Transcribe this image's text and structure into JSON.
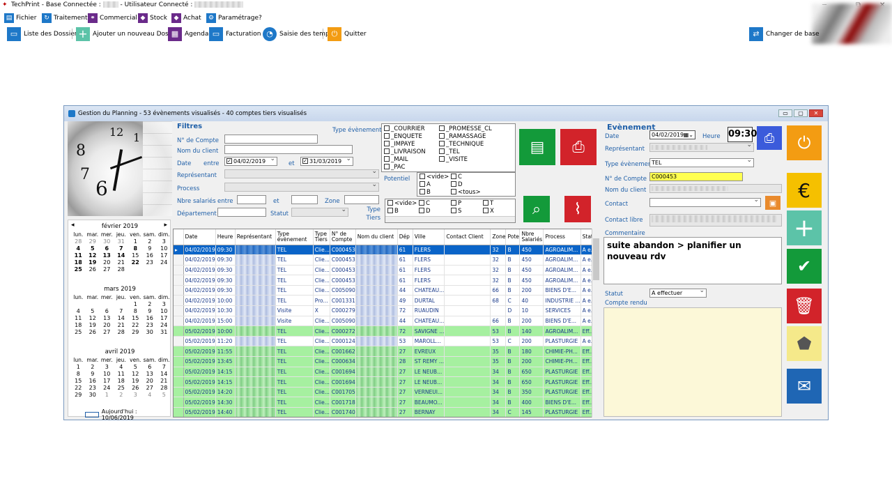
{
  "app": {
    "title": "TechPrint - Base Connectée :",
    "user_label": "- Utilisateur Connecté :",
    "min": "─",
    "max": "⧉",
    "close": "✕"
  },
  "menu": [
    {
      "label": "Fichier",
      "icon": "file-icon",
      "color": "#1e78c8"
    },
    {
      "label": "Traitement",
      "icon": "refresh-icon",
      "color": "#1e78c8"
    },
    {
      "label": "Commercial",
      "icon": "handshake-icon",
      "color": "#6a2a8a"
    },
    {
      "label": "Stock",
      "icon": "tag-icon",
      "color": "#6a2a8a"
    },
    {
      "label": "Achat",
      "icon": "tag-icon",
      "color": "#6a2a8a"
    },
    {
      "label": "Paramétrage",
      "icon": "gear-icon",
      "color": "#1e78c8"
    },
    {
      "label": "?",
      "icon": "",
      "color": ""
    }
  ],
  "toolbar": {
    "liste": "Liste des Dossiers",
    "ajouter": "Ajouter un nouveau Dossier",
    "agenda": "Agenda",
    "facturation": "Facturation BL",
    "saisie": "Saisie des temps",
    "quitter": "Quitter",
    "changer": "Changer de base"
  },
  "window": {
    "title": "Gestion du Planning - 53 évènements visualisés - 40 comptes tiers visualisés",
    "min": "▭",
    "max": "▢",
    "close": "✕"
  },
  "clock": {
    "n1": "12",
    "n2": "1",
    "n8": "8",
    "n7": "7",
    "n6": "6"
  },
  "calendar": {
    "prev": "◂",
    "next": "▸",
    "days": [
      "lun.",
      "mar.",
      "mer.",
      "jeu.",
      "ven.",
      "sam.",
      "dim."
    ],
    "months": [
      {
        "title": "février 2019",
        "cells": [
          [
            "28",
            "g"
          ],
          [
            "29",
            "g"
          ],
          [
            "30",
            "g"
          ],
          [
            "31",
            "g"
          ],
          [
            "1",
            ""
          ],
          [
            "2",
            ""
          ],
          [
            "3",
            ""
          ],
          [
            "4",
            "b"
          ],
          [
            "5",
            "b"
          ],
          [
            "6",
            "b"
          ],
          [
            "7",
            "b"
          ],
          [
            "8",
            "b"
          ],
          [
            "9",
            ""
          ],
          [
            "10",
            ""
          ],
          [
            "11",
            "b"
          ],
          [
            "12",
            "b"
          ],
          [
            "13",
            "b"
          ],
          [
            "14",
            "b"
          ],
          [
            "15",
            ""
          ],
          [
            "16",
            ""
          ],
          [
            "17",
            ""
          ],
          [
            "18",
            "b"
          ],
          [
            "19",
            "b"
          ],
          [
            "20",
            ""
          ],
          [
            "21",
            ""
          ],
          [
            "22",
            "b"
          ],
          [
            "23",
            ""
          ],
          [
            "24",
            ""
          ],
          [
            "25",
            "b"
          ],
          [
            "26",
            ""
          ],
          [
            "27",
            ""
          ],
          [
            "28",
            ""
          ],
          [
            "",
            ""
          ],
          [
            "",
            ""
          ],
          [
            "",
            ""
          ]
        ]
      },
      {
        "title": "mars 2019",
        "cells": [
          [
            "",
            ""
          ],
          [
            "",
            ""
          ],
          [
            "",
            ""
          ],
          [
            "",
            ""
          ],
          [
            "1",
            ""
          ],
          [
            "2",
            ""
          ],
          [
            "3",
            ""
          ],
          [
            "4",
            ""
          ],
          [
            "5",
            ""
          ],
          [
            "6",
            ""
          ],
          [
            "7",
            ""
          ],
          [
            "8",
            ""
          ],
          [
            "9",
            ""
          ],
          [
            "10",
            ""
          ],
          [
            "11",
            ""
          ],
          [
            "12",
            ""
          ],
          [
            "13",
            ""
          ],
          [
            "14",
            ""
          ],
          [
            "15",
            ""
          ],
          [
            "16",
            ""
          ],
          [
            "17",
            ""
          ],
          [
            "18",
            ""
          ],
          [
            "19",
            ""
          ],
          [
            "20",
            ""
          ],
          [
            "21",
            ""
          ],
          [
            "22",
            ""
          ],
          [
            "23",
            ""
          ],
          [
            "24",
            ""
          ],
          [
            "25",
            ""
          ],
          [
            "26",
            ""
          ],
          [
            "27",
            ""
          ],
          [
            "28",
            ""
          ],
          [
            "29",
            ""
          ],
          [
            "30",
            ""
          ],
          [
            "31",
            ""
          ]
        ]
      },
      {
        "title": "avril 2019",
        "cells": [
          [
            "1",
            ""
          ],
          [
            "2",
            ""
          ],
          [
            "3",
            ""
          ],
          [
            "4",
            ""
          ],
          [
            "5",
            ""
          ],
          [
            "6",
            ""
          ],
          [
            "7",
            ""
          ],
          [
            "8",
            ""
          ],
          [
            "9",
            ""
          ],
          [
            "10",
            ""
          ],
          [
            "11",
            ""
          ],
          [
            "12",
            ""
          ],
          [
            "13",
            ""
          ],
          [
            "14",
            ""
          ],
          [
            "15",
            ""
          ],
          [
            "16",
            ""
          ],
          [
            "17",
            ""
          ],
          [
            "18",
            ""
          ],
          [
            "19",
            ""
          ],
          [
            "20",
            ""
          ],
          [
            "21",
            ""
          ],
          [
            "22",
            ""
          ],
          [
            "23",
            ""
          ],
          [
            "24",
            ""
          ],
          [
            "25",
            ""
          ],
          [
            "26",
            ""
          ],
          [
            "27",
            ""
          ],
          [
            "28",
            ""
          ],
          [
            "29",
            ""
          ],
          [
            "30",
            ""
          ],
          [
            "1",
            "g"
          ],
          [
            "2",
            "g"
          ],
          [
            "3",
            "g"
          ],
          [
            "4",
            "g"
          ],
          [
            "5",
            "g"
          ]
        ]
      }
    ],
    "today": "Aujourd'hui : 10/06/2019"
  },
  "filters": {
    "title": "Filtres",
    "compte": "N° de Compte",
    "nom": "Nom du client",
    "date": "Date",
    "entre": "entre",
    "date1": "04/02/2019",
    "et": "et",
    "date2": "31/03/2019",
    "representant": "Représentant",
    "process": "Process",
    "nbre": "Nbre salariés",
    "entre2": "entre",
    "et2": "et",
    "zone": "Zone",
    "departement": "Département",
    "statut": "Statut",
    "type_evt": "Type évènement",
    "potentiel": "Potentiel",
    "type_tiers": "Type Tiers",
    "types": [
      "_COURRIER",
      "_ENQUETE",
      "_IMPAYE",
      "_LIVRAISON",
      "_MAIL",
      "_PAC",
      "_PROMESSE_CL",
      "_RAMASSAGE",
      "_TECHNIQUE",
      "_TEL",
      "_VISITE"
    ],
    "pot": [
      "<vide>",
      "C",
      "A",
      "D",
      "B",
      "<tous>"
    ],
    "tiers": [
      "<vide>",
      "C",
      "P",
      "T",
      "B",
      "D",
      "S",
      "X"
    ]
  },
  "grid": {
    "headers": [
      "Date",
      "Heure",
      "Représentant",
      "Type évènement",
      "Type Tiers",
      "N° de Compte",
      "Nom du client",
      "Dép",
      "Ville",
      "Contact Client",
      "Zone",
      "Pote",
      "Nbre Salariés",
      "Process",
      "Statu"
    ],
    "rows": [
      [
        "04/02/2019",
        "09:30",
        "",
        "TEL",
        "Clie...",
        "C000453",
        "",
        "61",
        "FLERS",
        "",
        "32",
        "B",
        "450",
        "AGROALIM...",
        "A e...",
        "sel"
      ],
      [
        "04/02/2019",
        "09:30",
        "",
        "TEL",
        "Clie...",
        "C000453",
        "",
        "61",
        "FLERS",
        "",
        "32",
        "B",
        "450",
        "AGROALIM...",
        "A e...",
        ""
      ],
      [
        "04/02/2019",
        "09:30",
        "",
        "TEL",
        "Clie...",
        "C000453",
        "",
        "61",
        "FLERS",
        "",
        "32",
        "B",
        "450",
        "AGROALIM...",
        "A e...",
        ""
      ],
      [
        "04/02/2019",
        "09:30",
        "",
        "TEL",
        "Clie...",
        "C000453",
        "",
        "61",
        "FLERS",
        "",
        "32",
        "B",
        "450",
        "AGROALIM...",
        "A e...",
        ""
      ],
      [
        "04/02/2019",
        "09:30",
        "",
        "TEL",
        "Clie...",
        "C005090",
        "",
        "44",
        "CHATEAU...",
        "",
        "66",
        "B",
        "200",
        "BIENS D'E...",
        "A e...",
        ""
      ],
      [
        "04/02/2019",
        "10:00",
        "",
        "TEL",
        "Pro...",
        "C001331",
        "",
        "49",
        "DURTAL",
        "",
        "68",
        "C",
        "40",
        "INDUSTRIE ...",
        "A e...",
        ""
      ],
      [
        "04/02/2019",
        "10:30",
        "",
        "Visite",
        "X",
        "C000279",
        "",
        "72",
        "RUAUDIN",
        "",
        "",
        "D",
        "10",
        "SERVICES",
        "A e...",
        ""
      ],
      [
        "04/02/2019",
        "15:00",
        "",
        "Visite",
        "Clie...",
        "C005090",
        "",
        "44",
        "CHATEAU...",
        "",
        "66",
        "B",
        "200",
        "BIENS D'E...",
        "A e...",
        ""
      ],
      [
        "05/02/2019",
        "10:00",
        "",
        "TEL",
        "Clie...",
        "C000272",
        "",
        "72",
        "SAVIGNE ...",
        "",
        "53",
        "B",
        "140",
        "AGROALIM...",
        "Eff...",
        "green"
      ],
      [
        "05/02/2019",
        "11:20",
        "",
        "TEL",
        "Clie...",
        "C000124",
        "",
        "53",
        "MAROLL...",
        "",
        "53",
        "C",
        "200",
        "PLASTURGIE",
        "A e...",
        ""
      ],
      [
        "05/02/2019",
        "11:55",
        "",
        "TEL",
        "Clie...",
        "C001662",
        "",
        "27",
        "EVREUX",
        "",
        "35",
        "B",
        "180",
        "CHIMIE-PH...",
        "Eff...",
        "green"
      ],
      [
        "05/02/2019",
        "13:45",
        "",
        "TEL",
        "Clie...",
        "C000634",
        "",
        "28",
        "ST REMY ...",
        "",
        "35",
        "B",
        "200",
        "CHIMIE-PH...",
        "Eff...",
        "green"
      ],
      [
        "05/02/2019",
        "14:15",
        "",
        "TEL",
        "Clie...",
        "C001694",
        "",
        "27",
        "LE NEUB...",
        "",
        "34",
        "B",
        "650",
        "PLASTURGIE",
        "Eff...",
        "green"
      ],
      [
        "05/02/2019",
        "14:15",
        "",
        "TEL",
        "Clie...",
        "C001694",
        "",
        "27",
        "LE NEUB...",
        "",
        "34",
        "B",
        "650",
        "PLASTURGIE",
        "Eff...",
        "green"
      ],
      [
        "05/02/2019",
        "14:20",
        "",
        "TEL",
        "Clie...",
        "C001705",
        "",
        "27",
        "VERNEUI...",
        "",
        "34",
        "B",
        "350",
        "PLASTURGIE",
        "Eff...",
        "green"
      ],
      [
        "05/02/2019",
        "14:30",
        "",
        "TEL",
        "Clie...",
        "C001718",
        "",
        "27",
        "BEAUMO...",
        "",
        "34",
        "B",
        "400",
        "BIENS D'E...",
        "Eff...",
        "green"
      ],
      [
        "05/02/2019",
        "14:40",
        "",
        "TEL",
        "Clie...",
        "C001740",
        "",
        "27",
        "BERNAY",
        "",
        "34",
        "C",
        "145",
        "PLASTURGIE",
        "Eff...",
        "green"
      ]
    ]
  },
  "event": {
    "title": "Evènement",
    "date_label": "Date",
    "date": "04/02/2019",
    "heure_label": "Heure",
    "heure": "09:30",
    "rep_label": "Représentant",
    "type_label": "Type évènement",
    "type": "TEL",
    "compte_label": "N° de Compte",
    "compte": "C000453",
    "nom_label": "Nom du client",
    "contact_label": "Contact",
    "contact_libre": "Contact libre",
    "commentaire_label": "Commentaire",
    "commentaire": "suite abandon > planifier un nouveau rdv",
    "statut_label": "Statut",
    "statut": "A effectuer",
    "compte_rendu_label": "Compte rendu"
  },
  "colors": {
    "accent": "#1e78c8",
    "green": "#139a3a",
    "red": "#d2232a",
    "orange": "#f39c12",
    "yellow": "#f5c000",
    "teal": "#5cc3a8",
    "blue": "#3b5bdb",
    "outlook": "#1f66b4"
  }
}
